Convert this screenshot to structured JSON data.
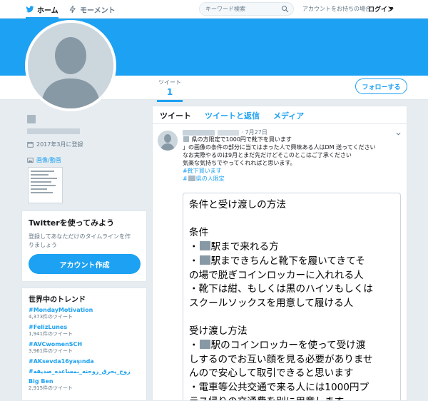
{
  "nav": {
    "home_label": "ホーム",
    "moments_label": "モーメント",
    "search_placeholder": "キーワード検索",
    "account_prompt": "アカウントをお持ちの場合",
    "login_label": "ログイン"
  },
  "profile": {
    "joined": "2017年3月に登録",
    "media_label": "画像/動画",
    "stats": {
      "tweets_label": "ツイート",
      "tweets_value": "1"
    },
    "follow_label": "フォローする"
  },
  "signup": {
    "title": "Twitterを使ってみよう",
    "desc_line1": "登録してあなただけのタイムラインを作",
    "desc_line2": "りましょう",
    "button": "アカウント作成"
  },
  "trends": {
    "title": "世界中のトレンド",
    "items": [
      {
        "name": "#MondayMotivation",
        "count": "4,373件のツイート"
      },
      {
        "name": "#FelizLunes",
        "count": "1,941件のツイート"
      },
      {
        "name": "#AVCwomenSCH",
        "count": "3,961件のツイート"
      },
      {
        "name": "#AKsevda16yaşında",
        "count": ""
      },
      {
        "name": "#زوج_يحرق_زوجته_بمساعده_صديقه",
        "count": ""
      },
      {
        "name": "Big Ben",
        "count": "2,915件のツイート"
      }
    ]
  },
  "timeline": {
    "tabs": [
      "ツイート",
      "ツイートと返信",
      "メディア"
    ],
    "tweet": {
      "date": "7月27日",
      "line1": "県の方限定で1000円で靴下を買います",
      "line2": "」の画像の条件の部分に当てはまった人で興味ある人はDM 送ってください",
      "line3": "なお実際やるのは9月とまだ先だけどそこのとこはご了承ください",
      "line4": "気楽な気持ちでやってくれればと思います。",
      "hashtag1": "#靴下買います",
      "hashtag2": "県の人限定",
      "image_text": {
        "title": "条件と受け渡しの方法",
        "cond_header": "条件",
        "c1": "駅まで来れる方",
        "c2a": "駅まできちんと靴下を履いてきてそ",
        "c2b": "の場で脱ぎコインロッカーに入れれる人",
        "c3a": "・靴下は紺、もしくは黒のハイソもしくは",
        "c3b": "スクールソックスを用意して履ける人",
        "method_header": "受け渡し方法",
        "m1a": "駅のコインロッカーを使って受け渡",
        "m1b": "しするのでお互い顔を見る必要がありませ",
        "m1c": "んので安心して取引できると思います",
        "m2a": "・電車等公共交通で来る人には1000円プ",
        "m2b": "ラス帰りの交通費を別に用意します"
      }
    }
  },
  "colors": {
    "accent": "#1da1f2",
    "background": "#e6ecf0",
    "muted": "#657786"
  }
}
